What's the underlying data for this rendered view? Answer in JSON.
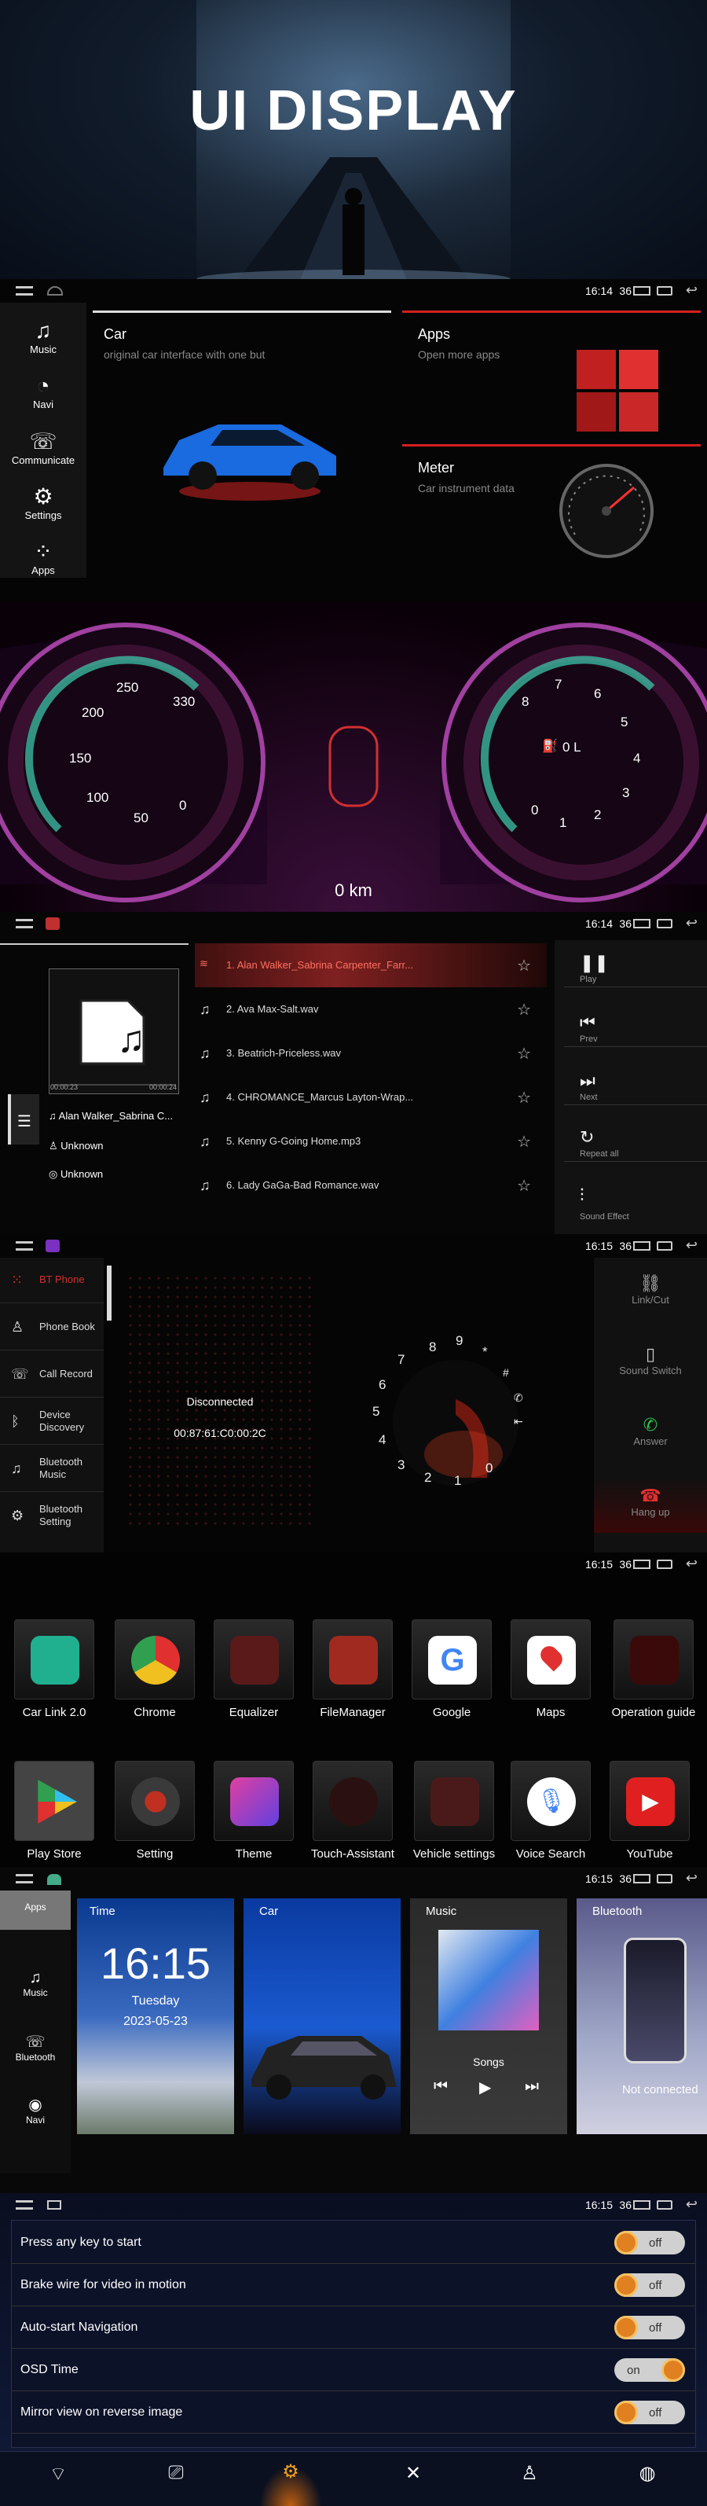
{
  "hero": {
    "title": "UI DISPLAY"
  },
  "home": {
    "status": {
      "time": "16:14",
      "signal": "36"
    },
    "side": [
      {
        "label": "Music",
        "icon": "music-note-icon"
      },
      {
        "label": "Navi",
        "icon": "compass-icon"
      },
      {
        "label": "Communicate",
        "icon": "phone-icon"
      },
      {
        "label": "Settings",
        "icon": "gear-icon"
      },
      {
        "label": "Apps",
        "icon": "apps-grid-icon"
      }
    ],
    "car": {
      "title": "Car",
      "sub": "original car interface with one but"
    },
    "apps": {
      "title": "Apps",
      "sub": "Open more apps"
    },
    "meter": {
      "title": "Meter",
      "sub": "Car instrument data"
    }
  },
  "cluster": {
    "left_ticks": [
      "250",
      "330",
      "200",
      "150",
      "100",
      "50",
      "0"
    ],
    "right_ticks": [
      "8",
      "7",
      "6",
      "5",
      "4",
      "3",
      "2",
      "1",
      "0"
    ],
    "fuel": "0 L",
    "odometer": "0 km"
  },
  "music": {
    "status": {
      "time": "16:14",
      "signal": "36"
    },
    "tracks": [
      "1. Alan Walker_Sabrina Carpenter_Farr...",
      "2. Ava Max-Salt.wav",
      "3. Beatrich-Priceless.wav",
      "4. CHROMANCE_Marcus Layton-Wrap...",
      "5. Kenny G-Going Home.mp3",
      "6. Lady GaGa-Bad Romance.wav"
    ],
    "time_start": "00:00:23",
    "time_end": "00:00:24",
    "now_title": "Alan Walker_Sabrina C...",
    "artist": "Unknown",
    "album": "Unknown",
    "controls": [
      {
        "label": "Play",
        "icon": "pause-icon"
      },
      {
        "label": "Prev",
        "icon": "prev-icon"
      },
      {
        "label": "Next",
        "icon": "next-icon"
      },
      {
        "label": "Repeat all",
        "icon": "repeat-icon"
      },
      {
        "label": "Sound Effect",
        "icon": "equalizer-icon"
      }
    ]
  },
  "bt": {
    "status": {
      "time": "16:15",
      "signal": "36"
    },
    "menu": [
      "BT Phone",
      "Phone Book",
      "Call Record",
      "Device Discovery",
      "Bluetooth Music",
      "Bluetooth Setting"
    ],
    "state": "Disconnected",
    "mac": "00:87:61:C0:00:2C",
    "dial": [
      "9",
      "8",
      "7",
      "6",
      "5",
      "4",
      "3",
      "2",
      "1",
      "0",
      "*",
      "#"
    ],
    "right": [
      "Link/Cut",
      "Sound Switch",
      "Answer",
      "Hang up"
    ]
  },
  "applist": {
    "status": {
      "time": "16:15",
      "signal": "36"
    },
    "row1": [
      "Car Link 2.0",
      "Chrome",
      "Equalizer",
      "FileManager",
      "Google",
      "Maps",
      "Operation guide"
    ],
    "row2": [
      "Play Store",
      "Setting",
      "Theme",
      "Touch-Assistant",
      "Vehicle settings",
      "Voice Search",
      "YouTube"
    ]
  },
  "widgets": {
    "status": {
      "time": "16:15",
      "signal": "36"
    },
    "side": [
      "Apps",
      "Music",
      "Bluetooth",
      "Navi"
    ],
    "time_card": {
      "title": "Time",
      "clock": "16:15",
      "day": "Tuesday",
      "date": "2023-05-23"
    },
    "car_card": {
      "title": "Car"
    },
    "music_card": {
      "title": "Music",
      "label": "Songs"
    },
    "bt_card": {
      "title": "Bluetooth",
      "status": "Not connected"
    }
  },
  "settings": {
    "status": {
      "time": "16:15",
      "signal": "36"
    },
    "rows": [
      {
        "label": "Press any key to start",
        "state": "off"
      },
      {
        "label": "Brake wire for video in motion",
        "state": "off"
      },
      {
        "label": "Auto-start Navigation",
        "state": "off"
      },
      {
        "label": "OSD Time",
        "state": "on"
      },
      {
        "label": "Mirror view on reverse image",
        "state": "off"
      }
    ],
    "nav_icons": [
      "wifi-icon",
      "display-icon",
      "gear-icon",
      "tools-icon",
      "user-icon",
      "globe-icon"
    ]
  },
  "colors": {
    "accent": "#d32020",
    "orange": "#e08020"
  }
}
